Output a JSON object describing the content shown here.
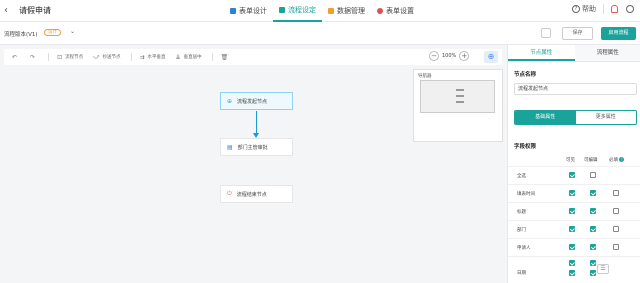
{
  "header": {
    "back_icon": "chevron-left-icon",
    "title": "请假申请",
    "tabs": [
      {
        "label": "表单设计",
        "icon": "form-icon",
        "color": "#2f7fd8"
      },
      {
        "label": "流程设定",
        "icon": "flow-icon",
        "color": "#1aa39a"
      },
      {
        "label": "数据管理",
        "icon": "data-icon",
        "color": "#f0a030"
      },
      {
        "label": "表单设置",
        "icon": "gear-icon",
        "color": "#e05050"
      }
    ],
    "active_tab": 1,
    "help_label": "帮助"
  },
  "subheader": {
    "version_label": "流程版本(V1)",
    "version_badge": "设计",
    "save_label": "保存",
    "publish_label": "启用流程"
  },
  "toolbar": {
    "items": [
      {
        "icon": "↶",
        "label": ""
      },
      {
        "icon": "↷",
        "label": ""
      },
      {
        "icon": "⊡",
        "label": "流程节点"
      },
      {
        "icon": "⤻",
        "label": "抄送节点"
      },
      {
        "icon": "⇉",
        "label": "水平垂直"
      },
      {
        "icon": "⇊",
        "label": "垂直居中"
      },
      {
        "icon": "🗑",
        "label": ""
      }
    ],
    "zoom_value": "100%"
  },
  "minimap": {
    "title": "导航器"
  },
  "nodes": [
    {
      "label": "流程发起节点",
      "icon": "⊕",
      "type": "start"
    },
    {
      "label": "部门主管审批",
      "icon": "▤",
      "type": "approve"
    },
    {
      "label": "流程结束节点",
      "icon": "⏻",
      "type": "end"
    }
  ],
  "panel": {
    "tabs": [
      "节点属性",
      "流程属性"
    ],
    "node_name_label": "节点名称",
    "node_name_value": "流程发起节点",
    "segments": [
      "基础属性",
      "更多属性"
    ],
    "field_perm_label": "字段权限",
    "columns": [
      "可见",
      "可编辑",
      "必填"
    ],
    "rows": [
      {
        "name": "全选",
        "visible": true,
        "editable": false,
        "required": null
      },
      {
        "name": "填表时间",
        "visible": true,
        "editable": true,
        "required": false
      },
      {
        "name": "标题",
        "visible": true,
        "editable": true,
        "required": false
      },
      {
        "name": "部门",
        "visible": true,
        "editable": true,
        "required": false
      },
      {
        "name": "申请人",
        "visible": true,
        "editable": true,
        "required": false
      },
      {
        "name": "日期",
        "visible": true,
        "editable": true,
        "required": null
      }
    ]
  },
  "colors": {
    "accent": "#1aa39a",
    "link": "#1a9ad6"
  }
}
